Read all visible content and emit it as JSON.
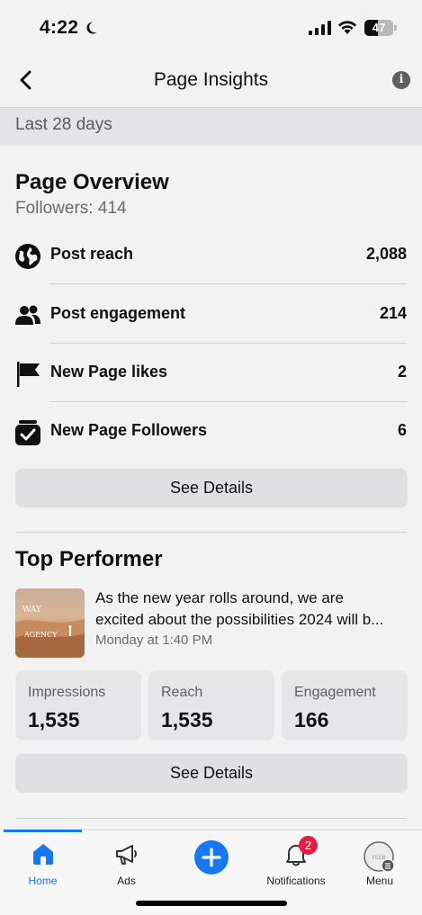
{
  "status": {
    "time": "4:22",
    "battery": "47",
    "battery_level": 0.47
  },
  "header": {
    "title": "Page Insights",
    "info_glyph": "i"
  },
  "range": {
    "label": "Last 28 days"
  },
  "overview": {
    "title": "Page Overview",
    "followers": "Followers: 414",
    "metrics": [
      {
        "label": "Post reach",
        "value": "2,088",
        "icon": "globe-icon"
      },
      {
        "label": "Post engagement",
        "value": "214",
        "icon": "people-icon"
      },
      {
        "label": "New Page likes",
        "value": "2",
        "icon": "flag-icon"
      },
      {
        "label": "New Page Followers",
        "value": "6",
        "icon": "followers-check-icon"
      }
    ],
    "details_label": "See Details"
  },
  "top_performer": {
    "title": "Top Performer",
    "post_line1": "As the new year rolls around, we are",
    "post_line2": "excited about the possibilities 2024 will b...",
    "post_date": "Monday at 1:40 PM",
    "thumb_text1": "WAY",
    "thumb_text2": "AGENCY",
    "stats": [
      {
        "label": "Impressions",
        "value": "1,535"
      },
      {
        "label": "Reach",
        "value": "1,535"
      },
      {
        "label": "Engagement",
        "value": "166"
      }
    ],
    "details_label": "See Details"
  },
  "tabs": [
    {
      "label": "Home",
      "icon": "home-icon",
      "active": true
    },
    {
      "label": "Ads",
      "icon": "megaphone-icon"
    },
    {
      "label": "",
      "icon": "plus-icon"
    },
    {
      "label": "Notifications",
      "icon": "bell-icon",
      "badge": "2"
    },
    {
      "label": "Menu",
      "icon": "menu-avatar-icon",
      "avatar_text": "FEEB"
    }
  ],
  "colors": {
    "accent": "#1877f2",
    "badge": "#e41e3f",
    "background": "#f2f2f2"
  }
}
